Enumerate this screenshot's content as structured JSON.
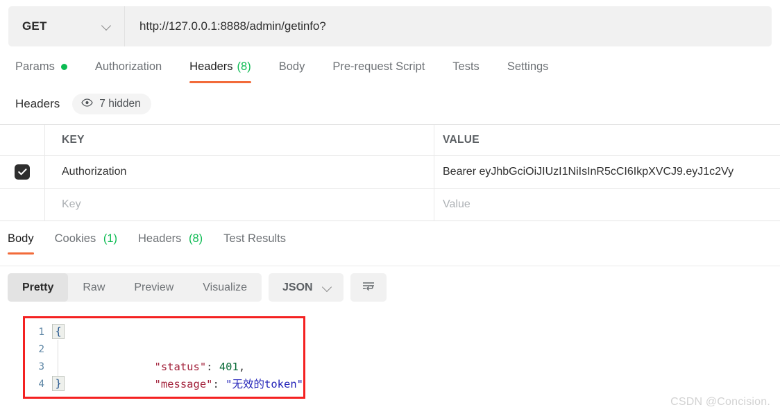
{
  "request": {
    "method": "GET",
    "url": "http://127.0.0.1:8888/admin/getinfo?",
    "tabs": [
      {
        "label": "Params",
        "dot": true,
        "active": false
      },
      {
        "label": "Authorization",
        "active": false
      },
      {
        "label": "Headers",
        "count": "(8)",
        "active": true
      },
      {
        "label": "Body",
        "active": false
      },
      {
        "label": "Pre-request Script",
        "active": false
      },
      {
        "label": "Tests",
        "active": false
      },
      {
        "label": "Settings",
        "active": false
      }
    ]
  },
  "headers_panel": {
    "title": "Headers",
    "hidden_badge": "7 hidden",
    "hidden_icon": "eye-icon",
    "columns": {
      "key": "KEY",
      "value": "VALUE"
    },
    "rows": [
      {
        "checked": true,
        "key": "Authorization",
        "value": "Bearer eyJhbGciOiJIUzI1NiIsInR5cCI6IkpXVCJ9.eyJ1c2Vy"
      }
    ],
    "new_row": {
      "key_placeholder": "Key",
      "value_placeholder": "Value"
    }
  },
  "response": {
    "tabs": [
      {
        "label": "Body",
        "active": true
      },
      {
        "label": "Cookies",
        "count": "(1)",
        "active": false
      },
      {
        "label": "Headers",
        "count": "(8)",
        "active": false
      },
      {
        "label": "Test Results",
        "active": false
      }
    ],
    "view_modes": [
      {
        "label": "Pretty",
        "active": true
      },
      {
        "label": "Raw",
        "active": false
      },
      {
        "label": "Preview",
        "active": false
      },
      {
        "label": "Visualize",
        "active": false
      }
    ],
    "format": "JSON",
    "wrap_icon": "word-wrap-icon",
    "body": {
      "line_numbers": [
        "1",
        "2",
        "3",
        "4"
      ],
      "fold_open": "{",
      "fold_close": "}",
      "lines": [
        {
          "segments": []
        },
        {
          "segments": [
            {
              "text": "    \"status\"",
              "cls": "k-key"
            },
            {
              "text": ": ",
              "cls": "k-pun"
            },
            {
              "text": "401",
              "cls": "k-num"
            },
            {
              "text": ",",
              "cls": "k-pun"
            }
          ]
        },
        {
          "segments": [
            {
              "text": "    \"message\"",
              "cls": "k-key"
            },
            {
              "text": ": ",
              "cls": "k-pun"
            },
            {
              "text": "\"无效的token\"",
              "cls": "k-str"
            }
          ]
        },
        {
          "segments": []
        }
      ],
      "highlight_color": "#f42121"
    }
  },
  "watermark": "CSDN @Concision.",
  "colors": {
    "accent": "#f26b3a",
    "green": "#0cbb52",
    "highlight": "#f42121",
    "toolbar_bg": "#f1f1f1"
  }
}
